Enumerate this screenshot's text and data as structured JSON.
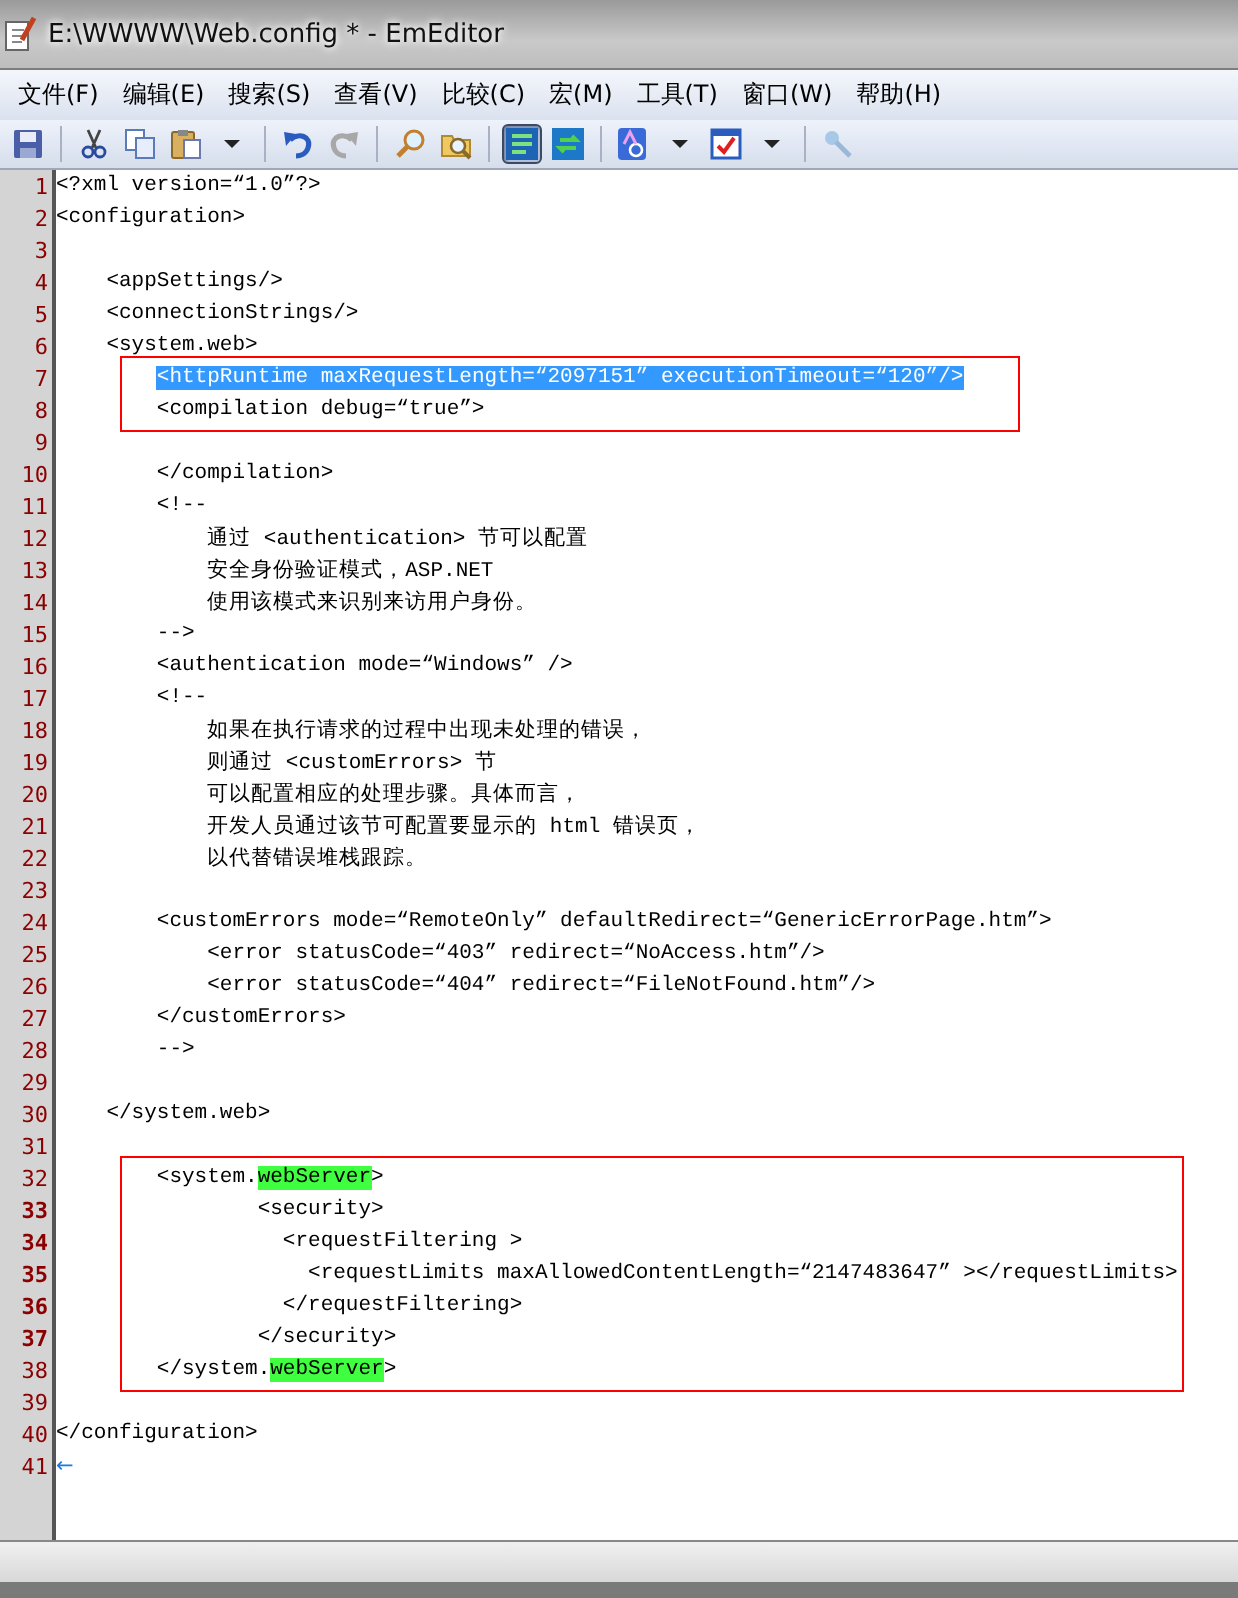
{
  "window": {
    "title": "E:\\WWWW\\Web.config * - EmEditor"
  },
  "menu": [
    {
      "label": "文件(F)"
    },
    {
      "label": "编辑(E)"
    },
    {
      "label": "搜索(S)"
    },
    {
      "label": "查看(V)"
    },
    {
      "label": "比较(C)"
    },
    {
      "label": "宏(M)"
    },
    {
      "label": "工具(T)"
    },
    {
      "label": "窗口(W)"
    },
    {
      "label": "帮助(H)"
    }
  ],
  "toolbar": [
    {
      "buttons": [
        {
          "kind": "save",
          "pressed": false
        }
      ]
    },
    {
      "buttons": [
        {
          "kind": "cut",
          "pressed": false
        },
        {
          "kind": "copy",
          "pressed": false
        },
        {
          "kind": "paste",
          "pressed": false
        },
        {
          "kind": "dropdown",
          "pressed": false
        }
      ]
    },
    {
      "buttons": [
        {
          "kind": "undo",
          "pressed": false
        },
        {
          "kind": "redo",
          "pressed": false
        }
      ]
    },
    {
      "buttons": [
        {
          "kind": "find",
          "pressed": false
        },
        {
          "kind": "find-files",
          "pressed": false
        }
      ]
    },
    {
      "buttons": [
        {
          "kind": "wrap",
          "pressed": true
        },
        {
          "kind": "refresh",
          "pressed": false
        }
      ]
    },
    {
      "buttons": [
        {
          "kind": "spell",
          "pressed": false
        },
        {
          "kind": "dropdown",
          "pressed": false
        },
        {
          "kind": "checklist",
          "pressed": false
        },
        {
          "kind": "dropdown",
          "pressed": false
        }
      ]
    },
    {
      "buttons": [
        {
          "kind": "pin",
          "pressed": false
        }
      ]
    }
  ],
  "editor": {
    "lines": [
      {
        "number": "1",
        "bold": false,
        "boxed": false,
        "segments": [
          {
            "kind": "plain",
            "text": "<?xml version=“1.0”?>"
          }
        ]
      },
      {
        "number": "2",
        "bold": false,
        "boxed": false,
        "segments": [
          {
            "kind": "plain",
            "text": "<configuration>"
          }
        ]
      },
      {
        "number": "3",
        "bold": false,
        "boxed": false
      },
      {
        "number": "4",
        "bold": false,
        "boxed": false,
        "segments": [
          {
            "kind": "plain",
            "text": "    <appSettings/>"
          }
        ]
      },
      {
        "number": "5",
        "bold": false,
        "boxed": false,
        "segments": [
          {
            "kind": "plain",
            "text": "    <connectionStrings/>"
          }
        ]
      },
      {
        "number": "6",
        "bold": false,
        "boxed": false,
        "segments": [
          {
            "kind": "plain",
            "text": "    <system.web>"
          }
        ]
      },
      {
        "number": "7",
        "bold": false,
        "boxed": true,
        "segments": [
          {
            "kind": "selection",
            "text": "        <httpRuntime maxRequestLength=“2097151” executionTimeout=“120”/>"
          }
        ]
      },
      {
        "number": "8",
        "bold": false,
        "boxed": true,
        "segments": [
          {
            "kind": "plain",
            "text": "        <compilation debug=“true”>"
          }
        ]
      },
      {
        "number": "9",
        "bold": false,
        "boxed": false
      },
      {
        "number": "10",
        "bold": false,
        "boxed": false,
        "segments": [
          {
            "kind": "plain",
            "text": "        </compilation>"
          }
        ]
      },
      {
        "number": "11",
        "bold": false,
        "boxed": false,
        "segments": [
          {
            "kind": "plain",
            "text": "        <!--"
          }
        ]
      },
      {
        "number": "12",
        "bold": false,
        "boxed": false,
        "segments": [
          {
            "kind": "plain",
            "text": "            通过 <authentication> 节可以配置"
          }
        ]
      },
      {
        "number": "13",
        "bold": false,
        "boxed": false,
        "segments": [
          {
            "kind": "plain",
            "text": "            安全身份验证模式，ASP.NET"
          }
        ]
      },
      {
        "number": "14",
        "bold": false,
        "boxed": false,
        "segments": [
          {
            "kind": "plain",
            "text": "            使用该模式来识别来访用户身份。"
          }
        ]
      },
      {
        "number": "15",
        "bold": false,
        "boxed": false,
        "segments": [
          {
            "kind": "plain",
            "text": "        -->"
          }
        ]
      },
      {
        "number": "16",
        "bold": false,
        "boxed": false,
        "segments": [
          {
            "kind": "plain",
            "text": "        <authentication mode=“Windows” />"
          }
        ]
      },
      {
        "number": "17",
        "bold": false,
        "boxed": false,
        "segments": [
          {
            "kind": "plain",
            "text": "        <!--"
          }
        ]
      },
      {
        "number": "18",
        "bold": false,
        "boxed": false,
        "segments": [
          {
            "kind": "plain",
            "text": "            如果在执行请求的过程中出现未处理的错误，"
          }
        ]
      },
      {
        "number": "19",
        "bold": false,
        "boxed": false,
        "segments": [
          {
            "kind": "plain",
            "text": "            则通过 <customErrors> 节"
          }
        ]
      },
      {
        "number": "20",
        "bold": false,
        "boxed": false,
        "segments": [
          {
            "kind": "plain",
            "text": "            可以配置相应的处理步骤。具体而言，"
          }
        ]
      },
      {
        "number": "21",
        "bold": false,
        "boxed": false,
        "segments": [
          {
            "kind": "plain",
            "text": "            开发人员通过该节可配置要显示的 html 错误页，"
          }
        ]
      },
      {
        "number": "22",
        "bold": false,
        "boxed": false,
        "segments": [
          {
            "kind": "plain",
            "text": "            以代替错误堆栈跟踪。"
          }
        ]
      },
      {
        "number": "23",
        "bold": false,
        "boxed": false
      },
      {
        "number": "24",
        "bold": false,
        "boxed": false,
        "segments": [
          {
            "kind": "plain",
            "text": "        <customErrors mode=“RemoteOnly” defaultRedirect=“GenericErrorPage.htm”>"
          }
        ]
      },
      {
        "number": "25",
        "bold": false,
        "boxed": false,
        "segments": [
          {
            "kind": "plain",
            "text": "            <error statusCode=“403” redirect=“NoAccess.htm”/>"
          }
        ]
      },
      {
        "number": "26",
        "bold": false,
        "boxed": false,
        "segments": [
          {
            "kind": "plain",
            "text": "            <error statusCode=“404” redirect=“FileNotFound.htm”/>"
          }
        ]
      },
      {
        "number": "27",
        "bold": false,
        "boxed": false,
        "segments": [
          {
            "kind": "plain",
            "text": "        </customErrors>"
          }
        ]
      },
      {
        "number": "28",
        "bold": false,
        "boxed": false,
        "segments": [
          {
            "kind": "plain",
            "text": "        -->"
          }
        ]
      },
      {
        "number": "29",
        "bold": false,
        "boxed": false
      },
      {
        "number": "30",
        "bold": false,
        "boxed": false,
        "segments": [
          {
            "kind": "plain",
            "text": "    </system.web>"
          }
        ]
      },
      {
        "number": "31",
        "bold": false,
        "boxed": false
      },
      {
        "number": "32",
        "bold": false,
        "boxed": true,
        "segments": [
          {
            "kind": "plain",
            "text": "        <system."
          },
          {
            "kind": "match",
            "text": "webServer"
          },
          {
            "kind": "plain",
            "text": ">"
          }
        ]
      },
      {
        "number": "33",
        "bold": true,
        "boxed": true,
        "segments": [
          {
            "kind": "plain",
            "text": "                <security>"
          }
        ]
      },
      {
        "number": "34",
        "bold": true,
        "boxed": true,
        "segments": [
          {
            "kind": "plain",
            "text": "                  <requestFiltering >"
          }
        ]
      },
      {
        "number": "35",
        "bold": true,
        "boxed": true,
        "segments": [
          {
            "kind": "plain",
            "text": "                    <requestLimits maxAllowedContentLength=“2147483647” ></requestLimits>"
          }
        ]
      },
      {
        "number": "36",
        "bold": true,
        "boxed": true,
        "segments": [
          {
            "kind": "plain",
            "text": "                  </requestFiltering>"
          }
        ]
      },
      {
        "number": "37",
        "bold": true,
        "boxed": true,
        "segments": [
          {
            "kind": "plain",
            "text": "                </security>"
          }
        ]
      },
      {
        "number": "38",
        "bold": false,
        "boxed": true,
        "segments": [
          {
            "kind": "plain",
            "text": "        </system."
          },
          {
            "kind": "match",
            "text": "webServer"
          },
          {
            "kind": "plain",
            "text": ">"
          }
        ]
      },
      {
        "number": "39",
        "bold": false,
        "boxed": false
      },
      {
        "number": "40",
        "bold": false,
        "boxed": false,
        "segments": [
          {
            "kind": "plain",
            "text": "</configuration>"
          }
        ]
      },
      {
        "number": "41",
        "bold": false,
        "boxed": false,
        "segments": [
          {
            "kind": "eof",
            "text": "←"
          }
        ]
      }
    ]
  }
}
